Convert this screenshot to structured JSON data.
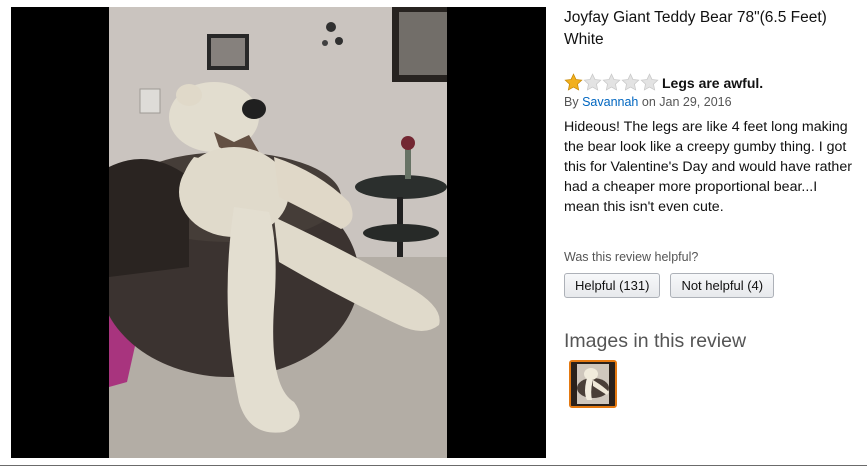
{
  "product": {
    "title": "Joyfay Giant Teddy Bear 78\"(6.5 Feet) White"
  },
  "review": {
    "rating": 1,
    "max_rating": 5,
    "title": "Legs are awful.",
    "by_prefix": "By",
    "author": "Savannah",
    "on_prefix": "on",
    "date": "Jan 29, 2016",
    "body": "Hideous! The legs are like 4 feet long making the bear look like a creepy gumby thing. I got this for Valentine's Day and would have rather had a cheaper more proportional bear...I mean this isn't even cute.",
    "helpful_question": "Was this review helpful?",
    "helpful_button": "Helpful (131)",
    "not_helpful_button": "Not helpful (4)"
  },
  "images_section": {
    "heading": "Images in this review"
  },
  "colors": {
    "star_filled": "#f2b01e",
    "star_empty": "#e3e3e3",
    "author_link": "#0066c0",
    "thumb_border": "#e47911"
  },
  "icons": {
    "star_filled": "star-filled-icon",
    "star_empty": "star-empty-icon"
  }
}
